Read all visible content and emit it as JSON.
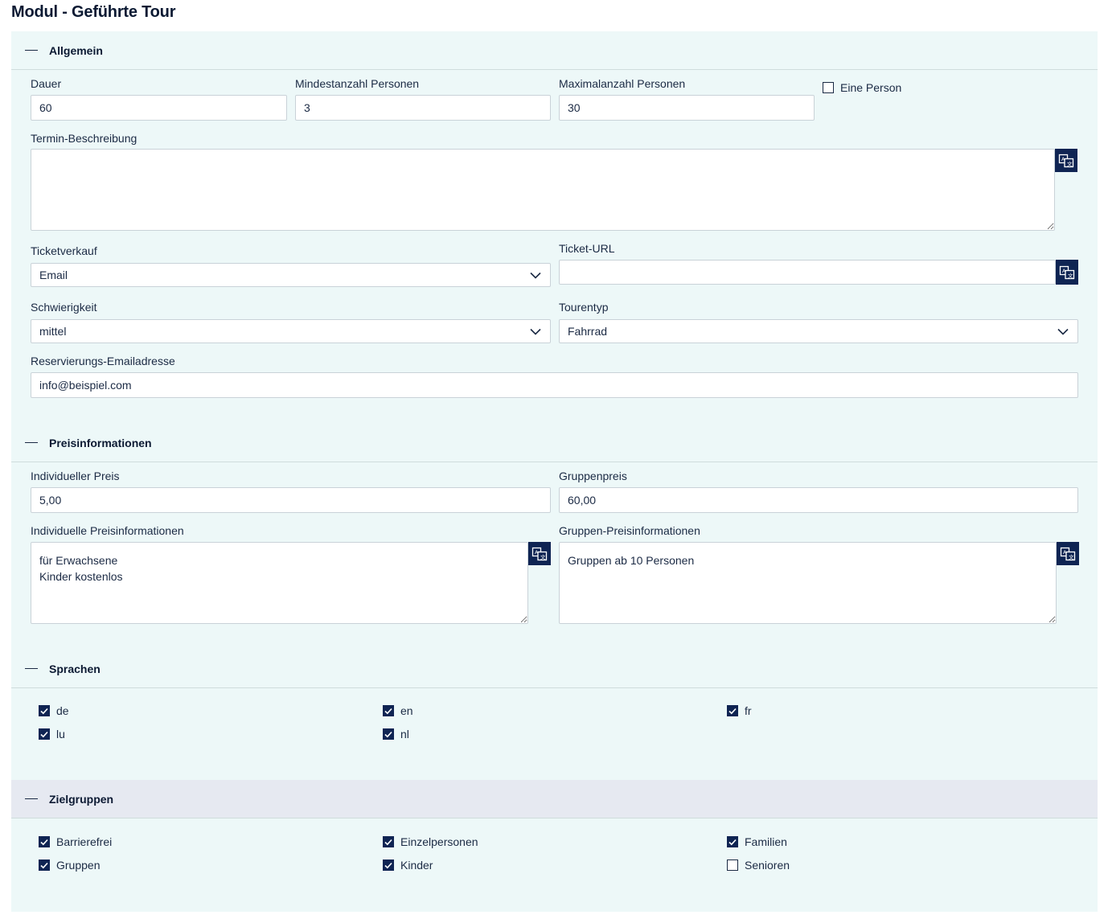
{
  "title": "Modul - Geführte Tour",
  "sections": {
    "general": {
      "title": "Allgemein",
      "duration": {
        "label": "Dauer",
        "value": "60"
      },
      "min_persons": {
        "label": "Mindestanzahl Personen",
        "value": "3"
      },
      "max_persons": {
        "label": "Maximalanzahl Personen",
        "value": "30"
      },
      "one_person": {
        "label": "Eine Person",
        "checked": false
      },
      "appointment_desc": {
        "label": "Termin-Beschreibung",
        "value": ""
      },
      "ticket_sale": {
        "label": "Ticketverkauf",
        "value": "Email"
      },
      "ticket_url": {
        "label": "Ticket-URL",
        "value": ""
      },
      "difficulty": {
        "label": "Schwierigkeit",
        "value": "mittel"
      },
      "tour_type": {
        "label": "Tourentyp",
        "value": "Fahrrad"
      },
      "reservation_email": {
        "label": "Reservierungs-Emailadresse",
        "value": "info@beispiel.com"
      }
    },
    "prices": {
      "title": "Preisinformationen",
      "individual_price": {
        "label": "Individueller Preis",
        "value": "5,00"
      },
      "group_price": {
        "label": "Gruppenpreis",
        "value": "60,00"
      },
      "individual_info": {
        "label": "Individuelle Preisinformationen",
        "value": "für Erwachsene\nKinder kostenlos"
      },
      "group_info": {
        "label": "Gruppen-Preisinformationen",
        "value": "Gruppen ab 10 Personen"
      }
    },
    "languages": {
      "title": "Sprachen",
      "items": [
        {
          "label": "de",
          "checked": true
        },
        {
          "label": "en",
          "checked": true
        },
        {
          "label": "fr",
          "checked": true
        },
        {
          "label": "lu",
          "checked": true
        },
        {
          "label": "nl",
          "checked": true
        }
      ]
    },
    "target_groups": {
      "title": "Zielgruppen",
      "items": [
        {
          "label": "Barrierefrei",
          "checked": true
        },
        {
          "label": "Einzelpersonen",
          "checked": true
        },
        {
          "label": "Familien",
          "checked": true
        },
        {
          "label": "Gruppen",
          "checked": true
        },
        {
          "label": "Kinder",
          "checked": true
        },
        {
          "label": "Senioren",
          "checked": false
        }
      ]
    }
  },
  "icons": {
    "translate": "translate-icon",
    "chevron": "chevron-down-icon",
    "check": "checkmark-icon",
    "collapse": "collapse-dash-icon"
  },
  "colors": {
    "section_bg": "#edf8f8",
    "header_alt_bg": "#e6e9f1",
    "accent": "#0f2453",
    "text": "#1b2a44"
  }
}
